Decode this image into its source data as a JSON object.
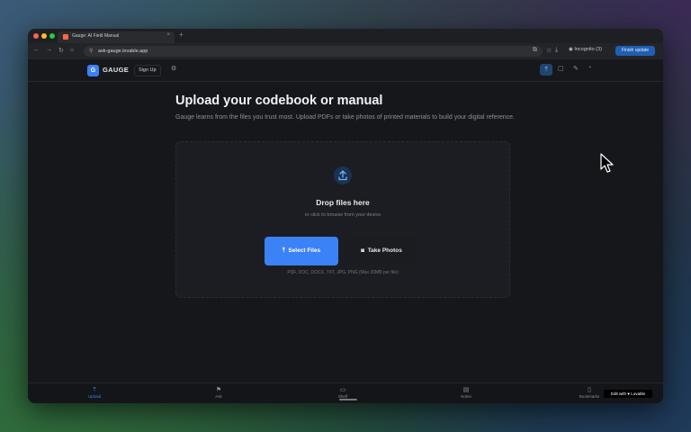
{
  "browser": {
    "tab_title": "Gauge: AI Field Manual",
    "url": "ask-gauge.lovable.app",
    "profile": "Incognito (3)",
    "finish_update": "Finish update",
    "colors": {
      "close": "#ff5f57",
      "minimize": "#febc2e",
      "maximize": "#28c840"
    }
  },
  "header": {
    "logo_letter": "G",
    "app_name": "GAUGE",
    "signup_label": "Sign Up"
  },
  "main": {
    "title": "Upload your codebook or manual",
    "subtitle": "Gauge learns from the files you trust most. Upload PDFs or take photos of printed materials to build your digital reference.",
    "dropzone": {
      "title": "Drop files here",
      "subtitle": "or click to browse from your device",
      "select_button": "Select Files",
      "photo_button": "Take Photos",
      "formats": "PDF, DOC, DOCX, TXT, JPG, PNG (Max 20MB per file)"
    }
  },
  "bottom_nav": [
    {
      "label": "Upload",
      "icon": "upload-icon",
      "active": true
    },
    {
      "label": "Ask",
      "icon": "flag-icon",
      "active": false
    },
    {
      "label": "Shelf",
      "icon": "folder-icon",
      "active": false
    },
    {
      "label": "Notes",
      "icon": "note-icon",
      "active": false
    },
    {
      "label": "Bookmarks",
      "icon": "bookmark-icon",
      "active": false
    }
  ],
  "badge": {
    "label": "Edit with ♥ Lovable"
  },
  "accent_color": "#3b82f6"
}
